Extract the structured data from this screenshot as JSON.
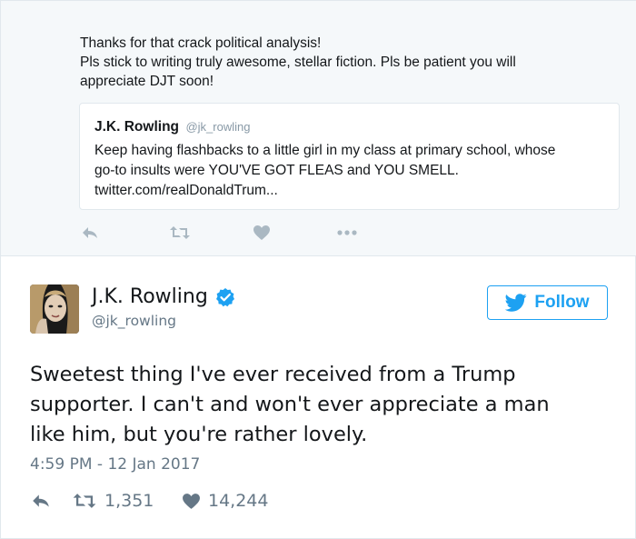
{
  "colors": {
    "brand": "#1da1f2",
    "muted": "#657786",
    "icon": "#aab8c2",
    "verified": "#1da1f2"
  },
  "parent_tweet": {
    "text_lines": [
      "Thanks for that crack political analysis!",
      "Pls stick to writing truly awesome, stellar fiction. Pls be patient you will",
      "appreciate DJT soon!"
    ],
    "quoted": {
      "name": "J.K. Rowling",
      "handle": "@jk_rowling",
      "text_lines": [
        "Keep having flashbacks to a little girl in my class at primary school, whose",
        "go-to insults were YOU'VE GOT FLEAS and YOU SMELL.",
        "twitter.com/realDonaldTrum..."
      ]
    },
    "actions": {
      "reply_icon": "reply-icon",
      "retweet_icon": "retweet-icon",
      "like_icon": "heart-icon",
      "more_icon": "more-icon"
    }
  },
  "tweet": {
    "author": {
      "display_name": "J.K. Rowling",
      "handle": "@jk_rowling",
      "verified": true
    },
    "follow_label": "Follow",
    "text_lines": [
      "Sweetest thing I've ever received from a Trump",
      "supporter. I can't and won't ever appreciate a man",
      "like him, but you're rather lovely."
    ],
    "timestamp": "4:59 PM - 12 Jan 2017",
    "retweets": "1,351",
    "likes": "14,244"
  }
}
